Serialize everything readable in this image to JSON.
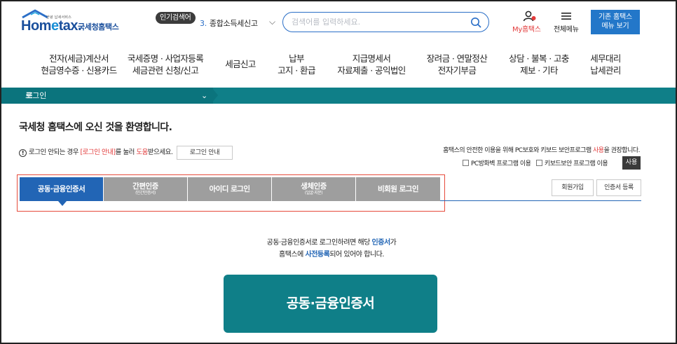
{
  "header": {
    "logo_tagline": "안녕 납세서비스",
    "logo_word_pre": "Hom",
    "logo_word_e": "e",
    "logo_word_post": "tax.",
    "logo_korean": "국세청홈택스",
    "popular_badge": "인기검색어",
    "popular_rank": "3.",
    "popular_term": "종합소득세신고",
    "search_placeholder": "검색어를 입력하세요.",
    "my_label": "My홈택스",
    "menu_label": "전체메뉴",
    "old_site_line1": "기존 홈택스",
    "old_site_line2": "메뉴 보기"
  },
  "nav": [
    {
      "line1": "전자(세금)계산서",
      "line2": "현금영수증 · 신용카드"
    },
    {
      "line1": "국세증명 · 사업자등록",
      "line2": "세금관련 신청/신고"
    },
    {
      "line1": "세금신고",
      "line2": ""
    },
    {
      "line1": "납부",
      "line2": "고지 · 환급"
    },
    {
      "line1": "지급명세서",
      "line2": "자료제출 · 공익법인"
    },
    {
      "line1": "장려금 · 연말정산",
      "line2": "전자기부금"
    },
    {
      "line1": "상담 · 불복 · 고충",
      "line2": "제보 · 기타"
    },
    {
      "line1": "세무대리",
      "line2": "납세관리"
    }
  ],
  "breadcrumb": {
    "label": "로그인"
  },
  "content": {
    "welcome": "국세청 홈택스에 오신 것을 환영합니다.",
    "help_pre": "로그인 안되는 경우 ",
    "help_red1": "[로그인 안내]",
    "help_mid": "를 눌러 ",
    "help_red2": "도움",
    "help_post": "받으세요.",
    "guide_button": "로그인 안내",
    "sec_notice_pre": "홈택스의 안전한 이용을 위해 PC보호와 키보드 보안프로그램 ",
    "sec_notice_red": "사용",
    "sec_notice_post": "을 권장합니다.",
    "chk_firewall": "PC방화벽 프로그램 이용",
    "chk_keyboard": "키보드보안 프로그램 이용",
    "use_button": "사용",
    "join_button": "회원가입",
    "cert_register_button": "인증서 등록",
    "desc_line1_pre": "공동·금융인증서로 로그인하려면 해당 ",
    "desc_line1_blue": "인증서",
    "desc_line1_post": "가",
    "desc_line2_pre": "홈택스에 ",
    "desc_line2_blue": "사전등록",
    "desc_line2_post": "되어 있어야 합니다.",
    "big_button": "공동·금융인증서"
  },
  "tabs": [
    {
      "label": "공동·금융인증서",
      "sub": "",
      "active": true
    },
    {
      "label": "간편인증",
      "sub": "(민간인증서)",
      "active": false
    },
    {
      "label": "아이디 로그인",
      "sub": "",
      "active": false
    },
    {
      "label": "생체인증",
      "sub": "(얼굴·지문)",
      "active": false
    },
    {
      "label": "비회원 로그인",
      "sub": "",
      "active": false
    }
  ],
  "colors": {
    "teal": "#0f7f88",
    "active_tab": "#2265b5",
    "inactive_tab": "#9e9e9e",
    "highlight": "#e64a3b",
    "accent_red": "#e23b3b"
  }
}
